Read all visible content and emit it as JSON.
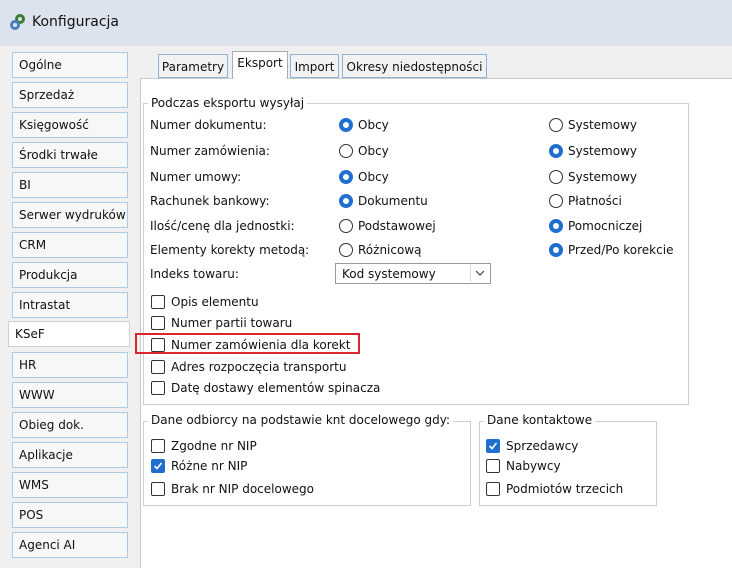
{
  "window": {
    "title": "Konfiguracja",
    "icon": "gears-icon"
  },
  "sidebar": {
    "items": [
      {
        "label": "Ogólne"
      },
      {
        "label": "Sprzedaż"
      },
      {
        "label": "Księgowość"
      },
      {
        "label": "Środki trwałe"
      },
      {
        "label": "BI"
      },
      {
        "label": "Serwer wydruków"
      },
      {
        "label": "CRM"
      },
      {
        "label": "Produkcja"
      },
      {
        "label": "Intrastat"
      },
      {
        "label": "KSeF"
      },
      {
        "label": "HR"
      },
      {
        "label": "WWW"
      },
      {
        "label": "Obieg dok."
      },
      {
        "label": "Aplikacje"
      },
      {
        "label": "WMS"
      },
      {
        "label": "POS"
      },
      {
        "label": "Agenci AI"
      }
    ],
    "selected": "KSeF"
  },
  "tabs": [
    {
      "label": "Parametry"
    },
    {
      "label": "Eksport"
    },
    {
      "label": "Import"
    },
    {
      "label": "Okresy niedostępności"
    }
  ],
  "active_tab": "Eksport",
  "export_group": {
    "legend": "Podczas eksportu wysyłaj",
    "rows": [
      {
        "label": "Numer dokumentu:",
        "opt1": "Obcy",
        "opt2": "Systemowy",
        "selected": 1
      },
      {
        "label": "Numer zamówienia:",
        "opt1": "Obcy",
        "opt2": "Systemowy",
        "selected": 2
      },
      {
        "label": "Numer umowy:",
        "opt1": "Obcy",
        "opt2": "Systemowy",
        "selected": 1
      },
      {
        "label": "Rachunek bankowy:",
        "opt1": "Dokumentu",
        "opt2": "Płatności",
        "selected": 1
      },
      {
        "label": "Ilość/cenę dla jednostki:",
        "opt1": "Podstawowej",
        "opt2": "Pomocniczej",
        "selected": 2
      },
      {
        "label": "Elementy korekty metodą:",
        "opt1": "Różnicową",
        "opt2": "Przed/Po korekcie",
        "selected": 2
      }
    ],
    "index_label": "Indeks towaru:",
    "index_value": "Kod systemowy",
    "checkboxes": [
      {
        "label": "Opis elementu",
        "checked": false
      },
      {
        "label": "Numer partii towaru",
        "checked": false
      },
      {
        "label": "Numer zamówienia dla korekt",
        "checked": false,
        "highlighted": true
      },
      {
        "label": "Adres rozpoczęcia transportu",
        "checked": false
      },
      {
        "label": "Datę dostawy elementów spinacza",
        "checked": false
      }
    ]
  },
  "recipient_group": {
    "legend": "Dane odbiorcy na podstawie knt docelowego gdy:",
    "checkboxes": [
      {
        "label": "Zgodne nr NIP",
        "checked": false
      },
      {
        "label": "Różne nr NIP",
        "checked": true
      },
      {
        "label": "Brak nr NIP docelowego",
        "checked": false
      }
    ]
  },
  "contact_group": {
    "legend": "Dane kontaktowe",
    "checkboxes": [
      {
        "label": "Sprzedawcy",
        "checked": true
      },
      {
        "label": "Nabywcy",
        "checked": false
      },
      {
        "label": "Podmiotów trzecich",
        "checked": false
      }
    ]
  },
  "colors": {
    "accent": "#1f6fcf",
    "highlight": "#d9262b",
    "titlebar": "#dde3ee"
  }
}
